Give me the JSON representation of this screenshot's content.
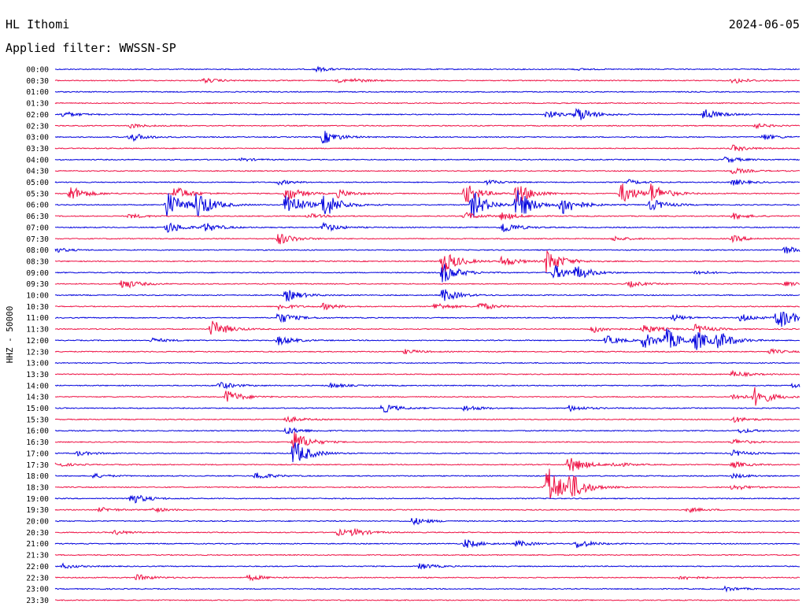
{
  "header": {
    "station": "HL Ithomi",
    "date": "2024-06-05",
    "filter": "Applied filter: WWSSN-SP"
  },
  "chart_data": {
    "type": "line",
    "ylabel": "HHZ - 50000",
    "colors": {
      "blue": "#0000dd",
      "red": "#ee1144"
    },
    "rows": [
      {
        "label": "00:00",
        "color": "blue",
        "events": [
          [
            0.35,
            3
          ],
          [
            0.7,
            1
          ]
        ]
      },
      {
        "label": "00:30",
        "color": "red",
        "events": [
          [
            0.2,
            3
          ],
          [
            0.38,
            2
          ],
          [
            0.4,
            2
          ],
          [
            0.91,
            4
          ]
        ]
      },
      {
        "label": "01:00",
        "color": "blue",
        "events": []
      },
      {
        "label": "01:30",
        "color": "red",
        "events": []
      },
      {
        "label": "02:00",
        "color": "blue",
        "events": [
          [
            0.01,
            4
          ],
          [
            0.66,
            5
          ],
          [
            0.7,
            10
          ],
          [
            0.87,
            8
          ]
        ]
      },
      {
        "label": "02:30",
        "color": "red",
        "events": [
          [
            0.1,
            3
          ],
          [
            0.94,
            3
          ]
        ]
      },
      {
        "label": "03:00",
        "color": "blue",
        "events": [
          [
            0.1,
            6
          ],
          [
            0.36,
            9
          ],
          [
            0.95,
            4
          ]
        ]
      },
      {
        "label": "03:30",
        "color": "red",
        "events": [
          [
            0.91,
            4
          ]
        ]
      },
      {
        "label": "04:00",
        "color": "blue",
        "events": [
          [
            0.25,
            2
          ],
          [
            0.9,
            4
          ]
        ]
      },
      {
        "label": "04:30",
        "color": "red",
        "events": [
          [
            0.91,
            4
          ]
        ]
      },
      {
        "label": "05:00",
        "color": "blue",
        "events": [
          [
            0.3,
            3
          ],
          [
            0.58,
            3
          ],
          [
            0.77,
            3
          ],
          [
            0.91,
            4
          ]
        ]
      },
      {
        "label": "05:30",
        "color": "red",
        "events": [
          [
            0.02,
            10
          ],
          [
            0.16,
            10
          ],
          [
            0.31,
            10
          ],
          [
            0.38,
            5
          ],
          [
            0.55,
            14
          ],
          [
            0.62,
            14
          ],
          [
            0.76,
            14
          ],
          [
            0.8,
            12
          ]
        ]
      },
      {
        "label": "06:00",
        "color": "blue",
        "events": [
          [
            0.15,
            18
          ],
          [
            0.19,
            18
          ],
          [
            0.31,
            18
          ],
          [
            0.36,
            18
          ],
          [
            0.56,
            18
          ],
          [
            0.62,
            20
          ],
          [
            0.68,
            14
          ],
          [
            0.8,
            8
          ]
        ]
      },
      {
        "label": "06:30",
        "color": "red",
        "events": [
          [
            0.1,
            3
          ],
          [
            0.34,
            3
          ],
          [
            0.55,
            5
          ],
          [
            0.6,
            5
          ],
          [
            0.91,
            4
          ]
        ]
      },
      {
        "label": "07:00",
        "color": "blue",
        "events": [
          [
            0.15,
            8
          ],
          [
            0.2,
            6
          ],
          [
            0.36,
            6
          ],
          [
            0.6,
            8
          ]
        ]
      },
      {
        "label": "07:30",
        "color": "red",
        "events": [
          [
            0.3,
            8
          ],
          [
            0.75,
            3
          ],
          [
            0.91,
            4
          ]
        ]
      },
      {
        "label": "08:00",
        "color": "blue",
        "events": [
          [
            0.0,
            3
          ],
          [
            0.98,
            5
          ]
        ]
      },
      {
        "label": "08:30",
        "color": "red",
        "events": [
          [
            0.52,
            16
          ],
          [
            0.6,
            7
          ],
          [
            0.66,
            16
          ]
        ]
      },
      {
        "label": "09:00",
        "color": "blue",
        "events": [
          [
            0.52,
            14
          ],
          [
            0.67,
            10
          ],
          [
            0.7,
            8
          ],
          [
            0.86,
            3
          ]
        ]
      },
      {
        "label": "09:30",
        "color": "red",
        "events": [
          [
            0.09,
            7
          ],
          [
            0.77,
            4
          ],
          [
            0.98,
            3
          ]
        ]
      },
      {
        "label": "10:00",
        "color": "blue",
        "events": [
          [
            0.31,
            8
          ],
          [
            0.52,
            9
          ]
        ]
      },
      {
        "label": "10:30",
        "color": "red",
        "events": [
          [
            0.3,
            4
          ],
          [
            0.36,
            4
          ],
          [
            0.51,
            5
          ],
          [
            0.57,
            5
          ]
        ]
      },
      {
        "label": "11:00",
        "color": "blue",
        "events": [
          [
            0.3,
            8
          ],
          [
            0.83,
            4
          ],
          [
            0.92,
            5
          ],
          [
            0.97,
            16
          ]
        ]
      },
      {
        "label": "11:30",
        "color": "red",
        "events": [
          [
            0.21,
            12
          ],
          [
            0.72,
            5
          ],
          [
            0.79,
            6
          ],
          [
            0.86,
            6
          ]
        ]
      },
      {
        "label": "12:00",
        "color": "blue",
        "events": [
          [
            0.13,
            3
          ],
          [
            0.3,
            6
          ],
          [
            0.74,
            6
          ],
          [
            0.79,
            10
          ],
          [
            0.82,
            14
          ],
          [
            0.86,
            12
          ],
          [
            0.89,
            10
          ]
        ]
      },
      {
        "label": "12:30",
        "color": "red",
        "events": [
          [
            0.47,
            3
          ],
          [
            0.96,
            3
          ]
        ]
      },
      {
        "label": "13:00",
        "color": "blue",
        "events": []
      },
      {
        "label": "13:30",
        "color": "red",
        "events": [
          [
            0.91,
            4
          ]
        ]
      },
      {
        "label": "14:00",
        "color": "blue",
        "events": [
          [
            0.22,
            5
          ],
          [
            0.37,
            3
          ],
          [
            0.99,
            3
          ]
        ]
      },
      {
        "label": "14:30",
        "color": "red",
        "events": [
          [
            0.23,
            9
          ],
          [
            0.91,
            4
          ],
          [
            0.94,
            12
          ]
        ]
      },
      {
        "label": "15:00",
        "color": "blue",
        "events": [
          [
            0.44,
            6
          ],
          [
            0.55,
            4
          ],
          [
            0.69,
            4
          ]
        ]
      },
      {
        "label": "15:30",
        "color": "red",
        "events": [
          [
            0.31,
            4
          ],
          [
            0.91,
            4
          ]
        ]
      },
      {
        "label": "16:00",
        "color": "blue",
        "events": [
          [
            0.31,
            5
          ],
          [
            0.92,
            3
          ]
        ]
      },
      {
        "label": "16:30",
        "color": "red",
        "events": [
          [
            0.32,
            14
          ],
          [
            0.91,
            4
          ]
        ]
      },
      {
        "label": "17:00",
        "color": "blue",
        "events": [
          [
            0.32,
            18
          ],
          [
            0.03,
            3
          ],
          [
            0.91,
            4
          ]
        ]
      },
      {
        "label": "17:30",
        "color": "red",
        "events": [
          [
            0.0,
            3
          ],
          [
            0.69,
            12
          ],
          [
            0.75,
            3
          ],
          [
            0.91,
            4
          ]
        ]
      },
      {
        "label": "18:00",
        "color": "blue",
        "events": [
          [
            0.05,
            3
          ],
          [
            0.27,
            5
          ],
          [
            0.91,
            3
          ]
        ]
      },
      {
        "label": "18:30",
        "color": "red",
        "events": [
          [
            0.66,
            30
          ],
          [
            0.69,
            16
          ],
          [
            0.91,
            4
          ]
        ]
      },
      {
        "label": "19:00",
        "color": "blue",
        "events": [
          [
            0.1,
            8
          ]
        ]
      },
      {
        "label": "19:30",
        "color": "red",
        "events": [
          [
            0.06,
            3
          ],
          [
            0.13,
            3
          ],
          [
            0.85,
            3
          ]
        ]
      },
      {
        "label": "20:00",
        "color": "blue",
        "events": [
          [
            0.48,
            5
          ]
        ]
      },
      {
        "label": "20:30",
        "color": "red",
        "events": [
          [
            0.08,
            3
          ],
          [
            0.38,
            4
          ],
          [
            0.4,
            4
          ]
        ]
      },
      {
        "label": "21:00",
        "color": "blue",
        "events": [
          [
            0.55,
            6
          ],
          [
            0.62,
            4
          ],
          [
            0.7,
            6
          ]
        ]
      },
      {
        "label": "21:30",
        "color": "red",
        "events": []
      },
      {
        "label": "22:00",
        "color": "blue",
        "events": [
          [
            0.01,
            3
          ],
          [
            0.49,
            4
          ]
        ]
      },
      {
        "label": "22:30",
        "color": "red",
        "events": [
          [
            0.11,
            4
          ],
          [
            0.26,
            4
          ],
          [
            0.84,
            3
          ]
        ]
      },
      {
        "label": "23:00",
        "color": "blue",
        "events": [
          [
            0.9,
            3
          ]
        ]
      },
      {
        "label": "23:30",
        "color": "red",
        "events": []
      }
    ]
  }
}
